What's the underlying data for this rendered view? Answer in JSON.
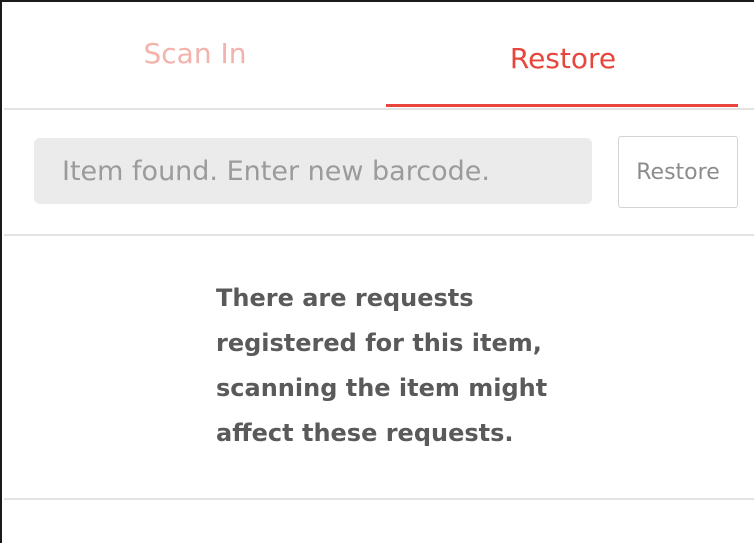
{
  "tabs": [
    {
      "label": "Scan In",
      "active": false
    },
    {
      "label": "Restore",
      "active": true
    }
  ],
  "search": {
    "placeholder": "Item found. Enter new barcode.",
    "value": ""
  },
  "restore_button": {
    "label": "Restore"
  },
  "message": {
    "lines": [
      "There are requests",
      "registered for this item,",
      "scanning the item might",
      "affect these requests."
    ]
  },
  "colors": {
    "accent": "#e8453c",
    "inactive_tab": "#f3b3ac",
    "divider": "#e3e3e3",
    "input_bg": "#ebebeb",
    "message_text": "#5a5a5a"
  }
}
